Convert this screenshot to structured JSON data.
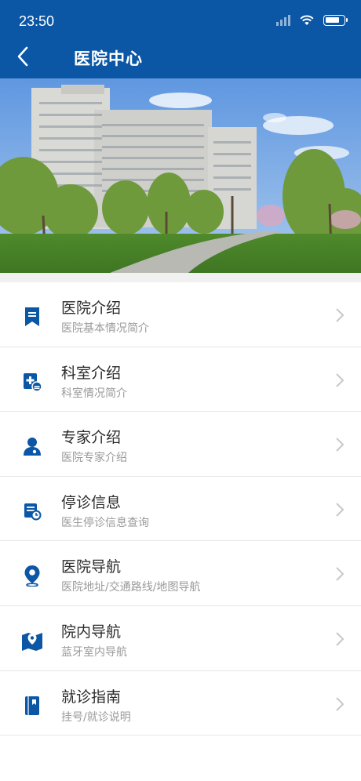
{
  "status_bar": {
    "time": "23:50"
  },
  "header": {
    "title": "医院中心"
  },
  "colors": {
    "header_bg": "#0b57a6",
    "icon_blue": "#0b57a6",
    "chevron": "#c8c8c8"
  },
  "menu": [
    {
      "label": "医院介绍",
      "sub": "医院基本情况简介",
      "icon": "bookmark-icon"
    },
    {
      "label": "科室介绍",
      "sub": "科室情况简介",
      "icon": "department-icon"
    },
    {
      "label": "专家介绍",
      "sub": "医院专家介绍",
      "icon": "doctor-icon"
    },
    {
      "label": "停诊信息",
      "sub": "医生停诊信息查询",
      "icon": "schedule-icon"
    },
    {
      "label": "医院导航",
      "sub": "医院地址/交通路线/地图导航",
      "icon": "location-pin-icon"
    },
    {
      "label": "院内导航",
      "sub": "蓝牙室内导航",
      "icon": "map-icon"
    },
    {
      "label": "就诊指南",
      "sub": "挂号/就诊说明",
      "icon": "guide-book-icon"
    }
  ]
}
